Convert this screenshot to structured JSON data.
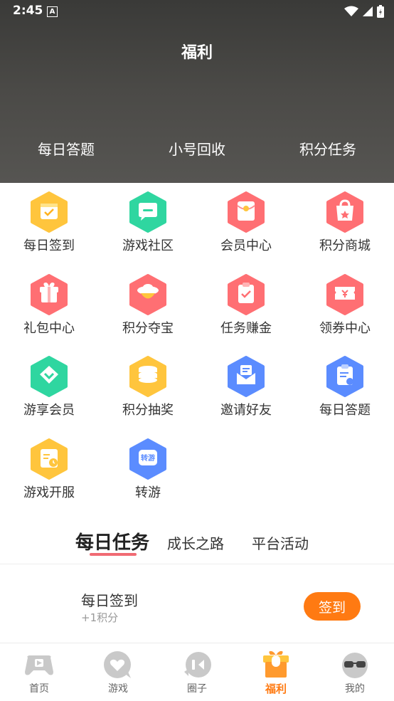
{
  "status": {
    "time": "2:45",
    "indicator": "A"
  },
  "header": {
    "title": "福利"
  },
  "top_nav": [
    "每日答题",
    "小号回收",
    "积分任务"
  ],
  "grid": [
    {
      "label": "每日签到",
      "icon": "calendar-check-icon",
      "color": "#ffc53d"
    },
    {
      "label": "游戏社区",
      "icon": "chat-bubble-icon",
      "color": "#2fd6a0"
    },
    {
      "label": "会员中心",
      "icon": "red-envelope-icon",
      "color": "#ff6f73"
    },
    {
      "label": "积分商城",
      "icon": "shopping-bag-icon",
      "color": "#ff6f73"
    },
    {
      "label": "礼包中心",
      "icon": "gift-box-icon",
      "color": "#ff6f73"
    },
    {
      "label": "积分夺宝",
      "icon": "treasure-icon",
      "color": "#ff6f73"
    },
    {
      "label": "任务赚金",
      "icon": "clipboard-check-icon",
      "color": "#ff6f73"
    },
    {
      "label": "领券中心",
      "icon": "coupon-icon",
      "color": "#ff6f73"
    },
    {
      "label": "游享会员",
      "icon": "vip-gem-icon",
      "color": "#2fd6a0"
    },
    {
      "label": "积分抽奖",
      "icon": "coin-stack-icon",
      "color": "#ffc53d"
    },
    {
      "label": "邀请好友",
      "icon": "invite-envelope-icon",
      "color": "#5b8cff"
    },
    {
      "label": "每日答题",
      "icon": "quiz-clipboard-icon",
      "color": "#5b8cff"
    },
    {
      "label": "游戏开服",
      "icon": "server-calendar-icon",
      "color": "#ffc53d"
    },
    {
      "label": "转游",
      "icon": "transfer-game-icon",
      "color": "#5b8cff",
      "badge": "转游"
    }
  ],
  "tabs": [
    "每日任务",
    "成长之路",
    "平台活动"
  ],
  "task": {
    "name": "每日签到",
    "points": "+1积分",
    "button": "签到"
  },
  "bottom_nav": [
    {
      "label": "首页",
      "icon": "gamepad-icon"
    },
    {
      "label": "游戏",
      "icon": "heart-game-icon"
    },
    {
      "label": "圈子",
      "icon": "circle-chat-icon"
    },
    {
      "label": "福利",
      "icon": "gift-icon",
      "active": true
    },
    {
      "label": "我的",
      "icon": "profile-face-icon"
    }
  ],
  "colors": {
    "accent": "#ff7a12",
    "tab_underline": "#f06a73"
  }
}
